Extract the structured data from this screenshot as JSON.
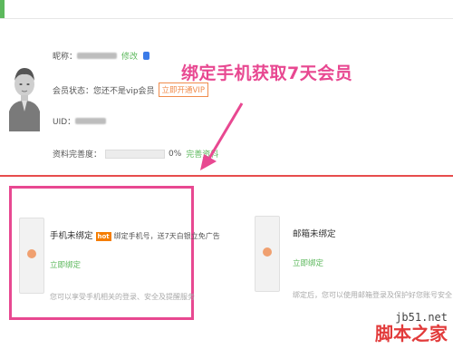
{
  "profile": {
    "nickname_label": "昵称：",
    "edit_link": "修改",
    "member_status_label": "会员状态：您还不是vip会员",
    "vip_button": "立即开通VIP",
    "uid_label": "UID：",
    "completeness_label": "资料完善度：",
    "completeness_value": "0%",
    "completeness_fraction": 0,
    "complete_link": "完善资料"
  },
  "annotation": {
    "text": "绑定手机获取7天会员",
    "color": "#e84891"
  },
  "cards": [
    {
      "title": "手机未绑定",
      "hot_label": "hot",
      "promo": "绑定手机号，送7天白银立免广告",
      "bind_link": "立即绑定",
      "description": "您可以享受手机相关的登录、安全及提醒服务"
    },
    {
      "title": "邮箱未绑定",
      "bind_link": "立即绑定",
      "description": "绑定后，您可以使用邮箱登录及保护好您账号安全"
    }
  ],
  "watermark": {
    "url": "jb51.net",
    "name": "脚本之家"
  },
  "colors": {
    "accent_green": "#5cb85c",
    "highlight_pink": "#e84891",
    "divider_red": "#e74c4c",
    "vip_orange": "#f08c4c"
  }
}
